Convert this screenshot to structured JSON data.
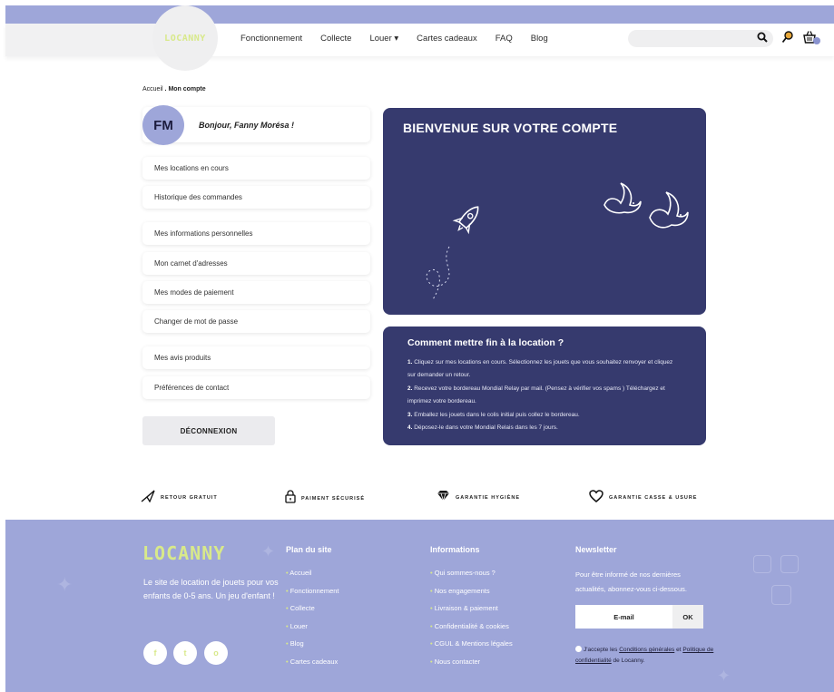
{
  "brand": {
    "logo": "LOCANNY",
    "accent": "#9ea6d9",
    "card_bg": "#363a6e",
    "logo_color": "#d8e98a"
  },
  "nav": {
    "items": [
      "Fonctionnement",
      "Collecte",
      "Louer ▾",
      "Cartes cadeaux",
      "FAQ",
      "Blog"
    ]
  },
  "header_icons": [
    "search-icon",
    "user-icon",
    "basket-icon"
  ],
  "breadcrumb": {
    "home": "Accueil",
    "sep": ".",
    "current": "Mon compte"
  },
  "account": {
    "initials": "FM",
    "greeting": "Bonjour, Fanny Morésa !",
    "menu": [
      "Mes locations en cours",
      "Historique des commandes",
      "Mes informations personnelles",
      "Mon carnet d'adresses",
      "Mes modes de paiement",
      "Changer de mot de passe",
      "Mes avis produits",
      "Préférences de contact"
    ],
    "logout": "DÉCONNEXION"
  },
  "welcome": {
    "title": "BIENVENUE SUR VOTRE COMPTE"
  },
  "howto": {
    "title": "Comment mettre fin à la location ?",
    "steps": [
      {
        "num": "1.",
        "text": " Cliquez sur mes locations en cours. Sélectionnez les jouets que vous souhaitez renvoyer et cliquez sur demander un retour."
      },
      {
        "num": "2.",
        "text": " Recevez votre bordereau Mondial Relay par mail. (Pensez à vérifier vos spams ) Téléchargez et imprimez votre bordereau."
      },
      {
        "num": "3.",
        "text": " Emballez les jouets dans le colis initial puis collez le bordereau."
      },
      {
        "num": "4.",
        "text": " Déposez-le dans votre Mondial Relais dans les 7 jours."
      }
    ]
  },
  "guarantees": [
    "RETOUR GRATUIT",
    "PAIMENT SÉCURISÉ",
    "GARANTIE HYGIÈNE",
    "GARANTIE CASSE & USURE"
  ],
  "footer": {
    "logo": "LOCANNY",
    "tagline": "Le site de location de jouets pour vos enfants de 0-5 ans. Un jeu d'enfant !",
    "social": [
      "f",
      "t",
      "o"
    ],
    "plan": {
      "title": "Plan du site",
      "items": [
        "Accueil",
        "Fonctionnement",
        "Collecte",
        "Louer",
        "Blog",
        "Cartes cadeaux"
      ]
    },
    "info": {
      "title": "Informations",
      "items": [
        "Qui sommes-nous ?",
        "Nos engagements",
        "Livraison & paiement",
        "Confidentialité & cookies",
        "CGUL & Mentions légales",
        "Nous contacter"
      ]
    },
    "newsletter": {
      "title": "Newsletter",
      "text": "Pour être informé de nos dernières actualités, abonnez-vous ci-dessous.",
      "email_placeholder": "E-mail",
      "ok": "OK",
      "consent_prefix": "J'accepte les ",
      "consent_link1": "Conditions générales",
      "consent_mid": " et ",
      "consent_link2": "Politique de confidentialité",
      "consent_suffix": " de Locanny."
    }
  }
}
